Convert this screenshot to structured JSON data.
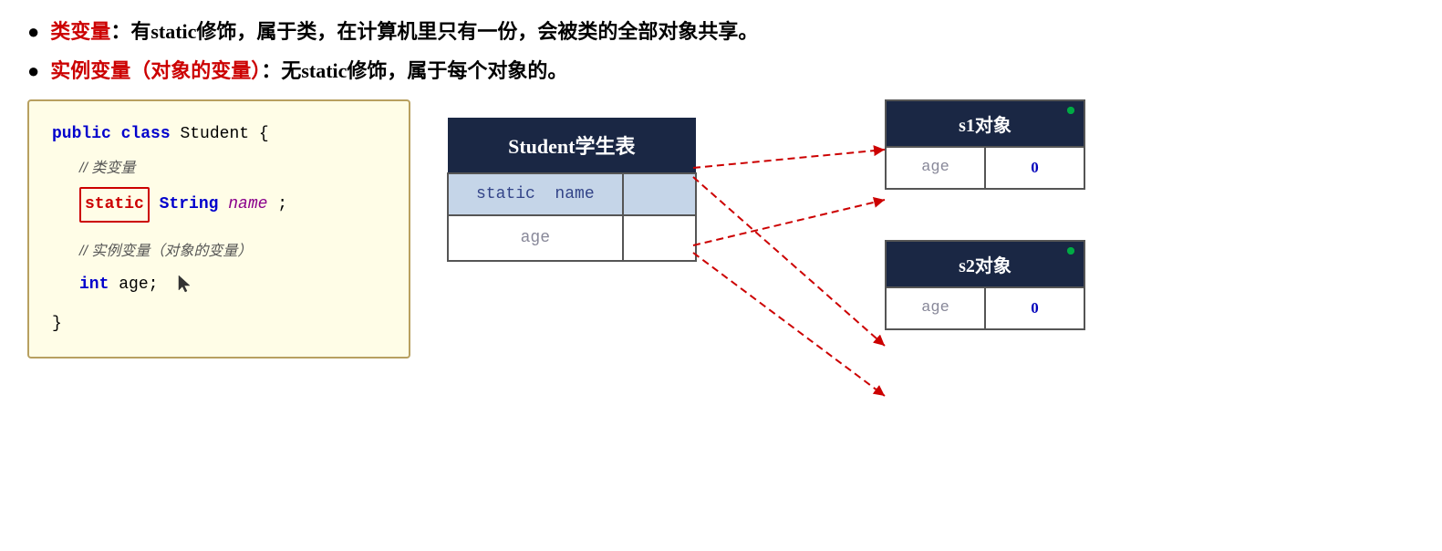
{
  "bullets": [
    {
      "id": "class-var",
      "red_part": "类变量",
      "separator": "：",
      "black_part": "有static修饰，属于类，在计算机里只有一份，会被类的全部对象共享。"
    },
    {
      "id": "instance-var",
      "red_part": "实例变量（对象的变量）",
      "separator": "：",
      "black_part": "无static修饰，属于每个对象的。"
    }
  ],
  "code": {
    "line1": "public class Student {",
    "comment1": "// 类变量",
    "line2_pre": "",
    "line2_static": "static",
    "line2_post": " String ",
    "line2_varname": "name",
    "line2_end": ";",
    "comment2": "// 实例变量（对象的变量）",
    "line3_kw": "int",
    "line3_var": " age;",
    "line4": "}"
  },
  "student_table": {
    "header": "Student学生表",
    "rows": [
      {
        "label": "static  name",
        "value": "",
        "type": "static"
      },
      {
        "label": "age",
        "value": "",
        "type": "instance"
      }
    ]
  },
  "objects": [
    {
      "id": "s1",
      "title": "s1对象",
      "fields": [
        {
          "label": "age",
          "value": "0"
        }
      ]
    },
    {
      "id": "s2",
      "title": "s2对象",
      "fields": [
        {
          "label": "age",
          "value": "0"
        }
      ]
    }
  ],
  "colors": {
    "red": "#cc0000",
    "dark_blue_header": "#1a2744",
    "static_row_bg": "#c5d5e8",
    "code_bg": "#fffde7",
    "code_border": "#b8a060",
    "green_dot": "#00aa44"
  }
}
